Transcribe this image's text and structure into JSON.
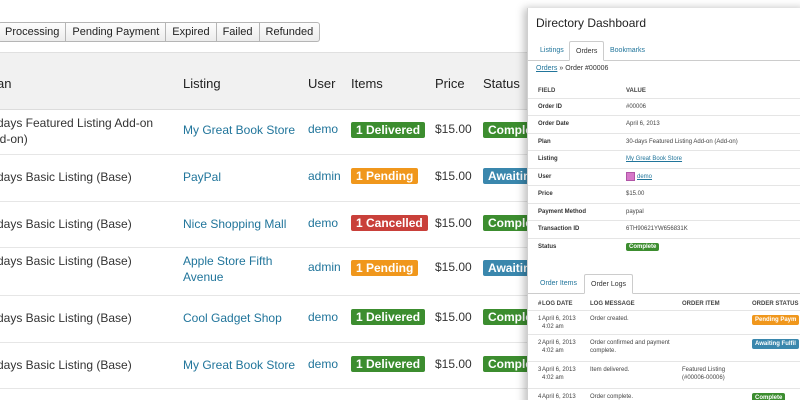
{
  "filters": [
    "Processing",
    "Pending Payment",
    "Expired",
    "Failed",
    "Refunded"
  ],
  "orders_table": {
    "headers": {
      "plan": "an",
      "listing": "Listing",
      "user": "User",
      "items": "Items",
      "price": "Price",
      "status": "Status"
    },
    "rows": [
      {
        "plan_line1": "-days Featured Listing Add-on",
        "plan_line2": "dd-on)",
        "listing_line1": "My Great Book Store",
        "listing_line2": "",
        "user": "demo",
        "items": "1 Delivered",
        "items_color": "#3c8d2f",
        "price": "$15.00",
        "status": "Complete",
        "status_color": "#3c8d2f"
      },
      {
        "plan_line1": "-days Basic Listing (Base)",
        "plan_line2": "",
        "listing_line1": "PayPal",
        "listing_line2": "",
        "user": "admin",
        "items": "1 Pending",
        "items_color": "#f0971c",
        "price": "$15.00",
        "status": "Awaiting",
        "status_color": "#3a87ad"
      },
      {
        "plan_line1": "-days Basic Listing (Base)",
        "plan_line2": "",
        "listing_line1": "Nice Shopping Mall",
        "listing_line2": "",
        "user": "demo",
        "items": "1 Cancelled",
        "items_color": "#c9403a",
        "price": "$15.00",
        "status": "Complete",
        "status_color": "#3c8d2f"
      },
      {
        "plan_line1": "-days Basic Listing (Base)",
        "plan_line2": "",
        "listing_line1": "Apple Store Fifth",
        "listing_line2": "Avenue",
        "user": "admin",
        "items": "1 Pending",
        "items_color": "#f0971c",
        "price": "$15.00",
        "status": "Awaiting",
        "status_color": "#3a87ad"
      },
      {
        "plan_line1": "-days Basic Listing (Base)",
        "plan_line2": "",
        "listing_line1": "Cool Gadget Shop",
        "listing_line2": "",
        "user": "demo",
        "items": "1 Delivered",
        "items_color": "#3c8d2f",
        "price": "$15.00",
        "status": "Complete",
        "status_color": "#3c8d2f"
      },
      {
        "plan_line1": "-days Basic Listing (Base)",
        "plan_line2": "",
        "listing_line1": "My Great Book Store",
        "listing_line2": "",
        "user": "demo",
        "items": "1 Delivered",
        "items_color": "#3c8d2f",
        "price": "$15.00",
        "status": "Complete",
        "status_color": "#3c8d2f"
      }
    ]
  },
  "panel": {
    "title": "Directory Dashboard",
    "tabs": [
      "Listings",
      "Orders",
      "Bookmarks"
    ],
    "breadcrumb_link": "Orders",
    "breadcrumb_sep": " » ",
    "breadcrumb_current": "Order #00006",
    "detail_header": {
      "field": "FIELD",
      "value": "VALUE"
    },
    "details": [
      {
        "key": "Order ID",
        "value": "#00006"
      },
      {
        "key": "Order Date",
        "value": "April 6, 2013"
      },
      {
        "key": "Plan",
        "value": "30-days Featured Listing Add-on (Add-on)"
      },
      {
        "key": "Listing",
        "value": "My Great Book Store"
      },
      {
        "key": "User",
        "value": "demo"
      },
      {
        "key": "Price",
        "value": "$15.00"
      },
      {
        "key": "Payment Method",
        "value": "paypal"
      },
      {
        "key": "Transaction ID",
        "value": "6TH90621YW656831K"
      },
      {
        "key": "Status",
        "value": "Complete"
      }
    ],
    "sub_tabs": [
      "Order Items",
      "Order Logs"
    ],
    "log_headers": {
      "num": "#",
      "date": "LOG DATE",
      "message": "LOG MESSAGE",
      "item": "ORDER ITEM",
      "status": "ORDER STATUS"
    },
    "logs": [
      {
        "num": "1",
        "date": "April 6, 2013",
        "time": "4:02 am",
        "message": "Order created.",
        "item": "",
        "status": "Pending Paym",
        "status_color": "#f0971c"
      },
      {
        "num": "2",
        "date": "April 6, 2013",
        "time": "4:02 am",
        "message": "Order confirmed and payment complete.",
        "item": "",
        "status": "Awaiting Fulfil",
        "status_color": "#3a87ad"
      },
      {
        "num": "3",
        "date": "April 6, 2013",
        "time": "4:02 am",
        "message": "Item delivered.",
        "item": "Featured Listing (#00006-00006)",
        "status": "",
        "status_color": ""
      },
      {
        "num": "4",
        "date": "April 6, 2013",
        "time": "4:02 am",
        "message": "Order complete.",
        "item": "",
        "status": "Complete",
        "status_color": "#3c8d2f"
      }
    ]
  }
}
